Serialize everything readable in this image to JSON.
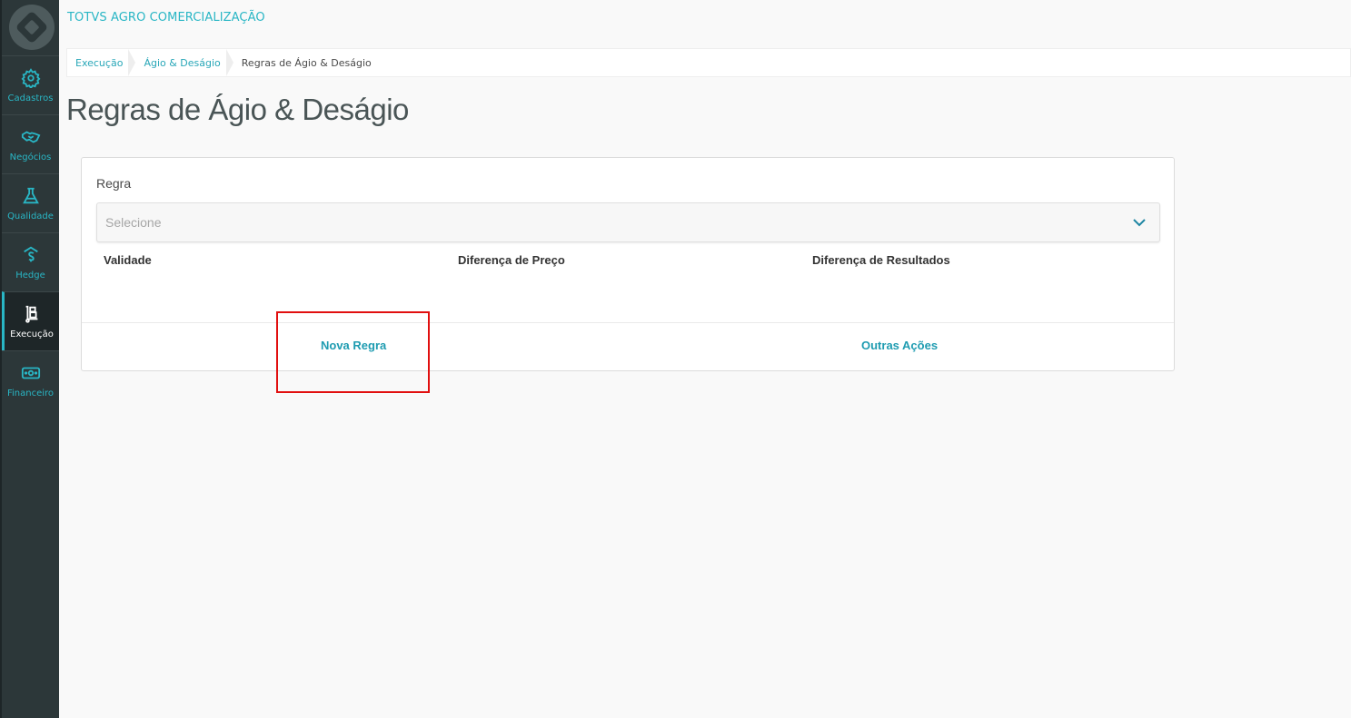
{
  "app": {
    "title": "TOTVS AGRO COMERCIALIZAÇÃO"
  },
  "sidebar": {
    "items": [
      {
        "label": "Cadastros",
        "icon": "gear-icon"
      },
      {
        "label": "Negócios",
        "icon": "handshake-icon"
      },
      {
        "label": "Qualidade",
        "icon": "flask-icon"
      },
      {
        "label": "Hedge",
        "icon": "dollar-icon"
      },
      {
        "label": "Execução",
        "icon": "hand-truck-icon",
        "active": true
      },
      {
        "label": "Financeiro",
        "icon": "money-icon"
      }
    ]
  },
  "breadcrumb": {
    "items": [
      {
        "label": "Execução"
      },
      {
        "label": "Ágio & Deságio"
      },
      {
        "label": "Regras de Ágio & Deságio"
      }
    ]
  },
  "page": {
    "title": "Regras de Ágio & Deságio"
  },
  "form": {
    "rule_label": "Regra",
    "rule_placeholder": "Selecione",
    "columns": [
      "Validade",
      "Diferença de Preço",
      "Diferença de Resultados"
    ]
  },
  "actions": {
    "new_rule": "Nova Regra",
    "other_actions": "Outras Ações"
  },
  "colors": {
    "accent": "#29b6c5",
    "sidebar_bg": "#2c3739",
    "highlight": "#e10f0f"
  }
}
